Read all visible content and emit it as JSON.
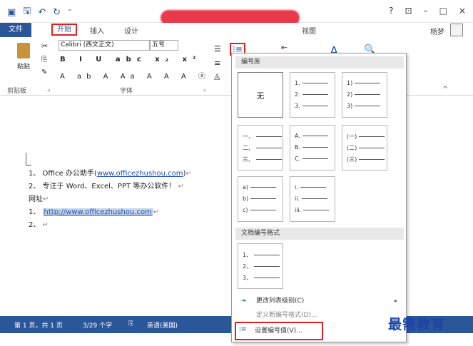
{
  "titlebar": {
    "qat_icons": [
      "word-icon",
      "save-icon",
      "undo-icon",
      "redo-icon"
    ],
    "window_buttons": [
      "?",
      "⊡",
      "–",
      "□",
      "×"
    ]
  },
  "tabs": {
    "file": "文件",
    "home": "开始",
    "insert": "插入",
    "design": "设计",
    "view": "视图",
    "user": "杨梦"
  },
  "ribbon": {
    "paste_label": "粘贴",
    "clipboard_label": "剪贴板",
    "font_label": "字体",
    "font_name": "Calibri (西文正文)",
    "font_size": "五号",
    "format_row": "B I U abc x₂ x²",
    "format_row2": "A ab A Aa A A A ⓐ",
    "number_icon": "⁝≡"
  },
  "document": {
    "lines": [
      {
        "prefix": "1、 Office 办公助手(",
        "link": "www.officezhushou.com",
        "suffix": ")"
      },
      {
        "text": "2、 专注于 Word、Excel、PPT 等办公软件！"
      },
      {
        "text": "网址"
      },
      {
        "prefix": "1、 ",
        "link": "http://www.officezhushou.com"
      },
      {
        "text": "2、"
      }
    ]
  },
  "menu": {
    "library_title": "编号库",
    "doc_formats_title": "文档编号格式",
    "none_label": "无",
    "tiles": [
      [
        "1.",
        "2.",
        "3."
      ],
      [
        "1)",
        "2)",
        "3)"
      ],
      [
        "一、",
        "二、",
        "三、"
      ],
      [
        "A.",
        "B.",
        "C."
      ],
      [
        "(一)",
        "(二)",
        "(三)"
      ],
      [
        "a)",
        "b)",
        "c)"
      ],
      [
        "i.",
        "ii.",
        "iii."
      ]
    ],
    "doc_tile": [
      "1、",
      "2、",
      "3、"
    ],
    "items": {
      "change_level": "更改列表级别(C)",
      "define_format": "定义新编号格式(D)...",
      "set_value": "设置编号值(V)..."
    }
  },
  "status": {
    "page": "第 1 页，共 1 页",
    "words": "3/29 个字",
    "language": "英语(美国)"
  },
  "watermark": "最需教育"
}
